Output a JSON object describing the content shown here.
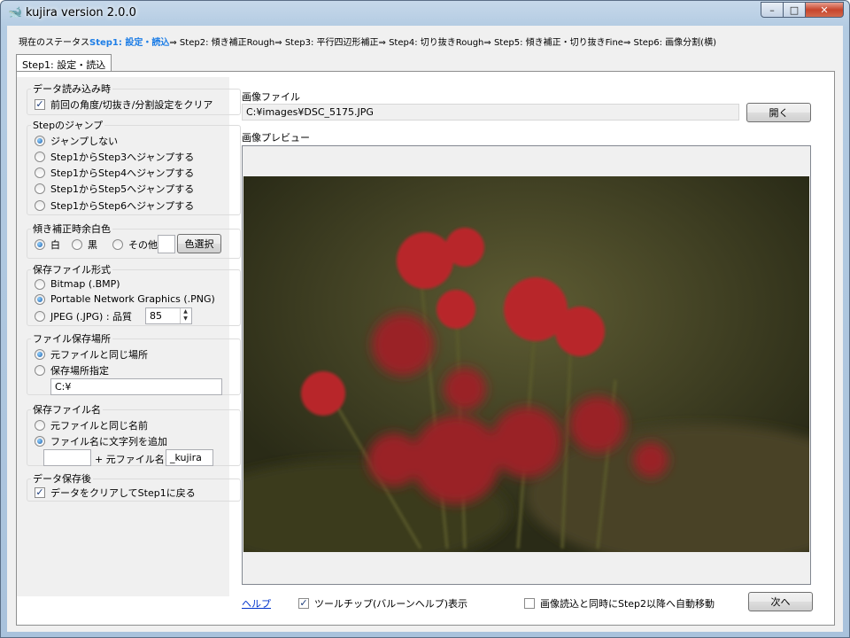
{
  "window": {
    "title": "kujira version 2.0.0",
    "app_icon": "whale-icon",
    "buttons": {
      "minimize": "–",
      "maximize": "□",
      "close": "✕"
    }
  },
  "status": {
    "label": "現在のステータス",
    "active": "Step1: 設定・読込",
    "steps": [
      "⇒ Step2: 傾き補正Rough",
      "⇒ Step3: 平行四辺形補正",
      "⇒ Step4: 切り抜きRough",
      "⇒ Step5: 傾き補正・切り抜きFine",
      "⇒ Step6: 画像分割(横)"
    ],
    "active_color": "#1e7ee6"
  },
  "tab": {
    "label": "Step1: 設定・読込"
  },
  "groups": {
    "load": {
      "title": "データ読み込み時",
      "clear_label": "前回の角度/切抜き/分割設定をクリア",
      "clear_checked": true
    },
    "jump": {
      "title": "Stepのジャンプ",
      "options": [
        "ジャンプしない",
        "Step1からStep3へジャンプする",
        "Step1からStep4へジャンプする",
        "Step1からStep5へジャンプする",
        "Step1からStep6へジャンプする"
      ],
      "selected": 0
    },
    "margin": {
      "title": "傾き補正時余白色",
      "white": "白",
      "black": "黒",
      "other": "その他",
      "selected": "white",
      "color_button": "色選択",
      "swatch_color": "#ffffff"
    },
    "format": {
      "title": "保存ファイル形式",
      "bmp": "Bitmap (.BMP)",
      "png": "Portable Network Graphics (.PNG)",
      "jpeg": "JPEG (.JPG) : 品質",
      "quality": "85",
      "selected": "png"
    },
    "location": {
      "title": "ファイル保存場所",
      "same": "元ファイルと同じ場所",
      "specify": "保存場所指定",
      "path": "C:¥",
      "selected": "same"
    },
    "filename": {
      "title": "保存ファイル名",
      "same": "元ファイルと同じ名前",
      "append": "ファイル名に文字列を追加",
      "prefix": "",
      "middle": "+ 元ファイル名+",
      "suffix": "_kujira",
      "selected": "append"
    },
    "after_save": {
      "title": "データ保存後",
      "clear_label": "データをクリアしてStep1に戻る",
      "checked": true
    }
  },
  "image": {
    "file_label": "画像ファイル",
    "path": "C:¥images¥DSC_5175.JPG",
    "open_button": "開く",
    "preview_label": "画像プレビュー"
  },
  "footer": {
    "help": "ヘルプ",
    "tooltip_label": "ツールチップ(バルーンヘルプ)表示",
    "tooltip_checked": true,
    "auto_label": "画像読込と同時にStep2以降へ自動移動",
    "auto_checked": false,
    "next_button": "次へ"
  }
}
